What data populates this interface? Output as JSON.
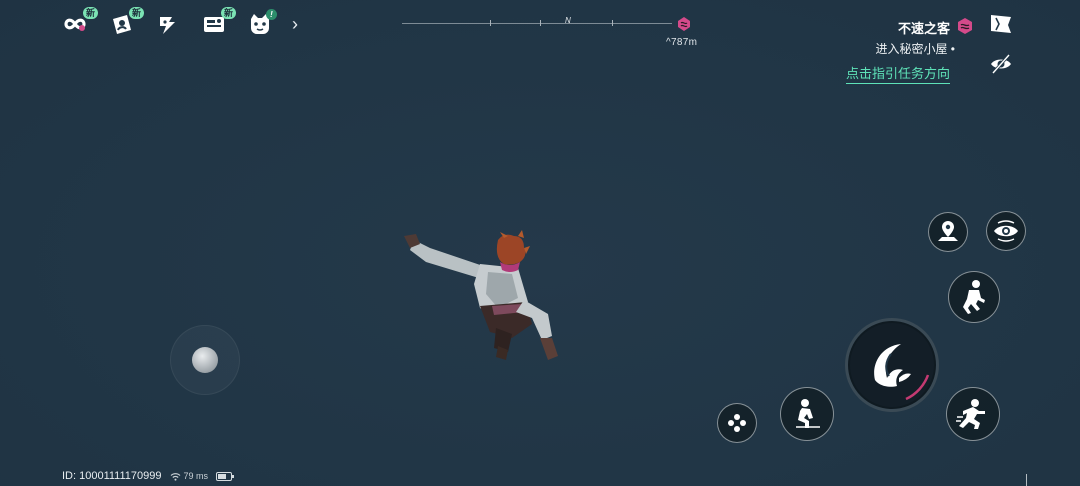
{
  "top_menu": {
    "items": [
      {
        "icon": "infinity-icon",
        "badge": "新"
      },
      {
        "icon": "character-card-icon",
        "badge": "新"
      },
      {
        "icon": "shout-icon",
        "badge": ""
      },
      {
        "icon": "stamp-card-icon",
        "badge": "新"
      },
      {
        "icon": "cat-mascot-icon",
        "badge": ""
      }
    ],
    "more_icon": "chevron-right-icon",
    "alert_text": "!"
  },
  "compass": {
    "heading_label": "N",
    "distance": "^787m",
    "marker_icon": "quest-marker-icon"
  },
  "quest": {
    "title": "不速之客",
    "objective": "进入秘密小屋 •",
    "guide_link": "点击指引任务方向"
  },
  "right_icons": {
    "flag": "flag-icon",
    "hide_ui": "hide-ui-icon"
  },
  "actions": {
    "emote": "emote-wheel-icon",
    "crouch": "crouch-icon",
    "main": "wave-slash-icon",
    "sprint": "sprint-icon",
    "jump": "jump-icon",
    "map_pin": "map-pin-icon",
    "view": "eye-view-icon"
  },
  "status": {
    "player_id": "ID: 10001111170999",
    "ping": "79 ms",
    "battery_level": 0.7
  },
  "colors": {
    "background": "#213747",
    "accent_green": "#5ee2b8",
    "badge_green": "#7be3b4",
    "quest_pink": "#d44a8a"
  }
}
